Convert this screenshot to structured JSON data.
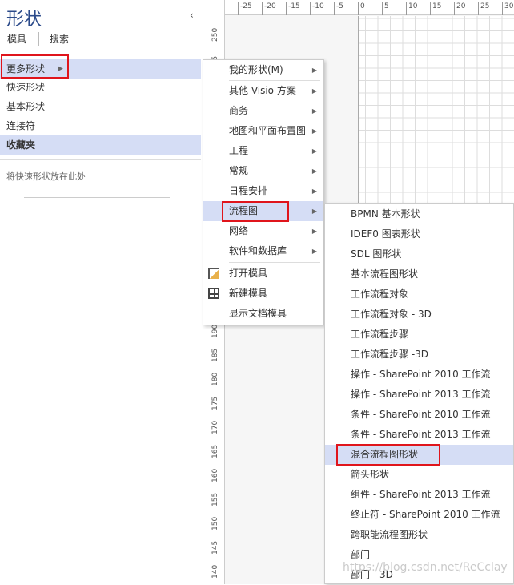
{
  "sidebar": {
    "title": "形状",
    "collapse_icon": "chevron-left-icon",
    "tabs": [
      "模具",
      "搜索"
    ],
    "items": [
      {
        "label": "更多形状",
        "selected": true
      },
      {
        "label": "快速形状"
      },
      {
        "label": "基本形状"
      },
      {
        "label": "连接符"
      },
      {
        "label": "收藏夹",
        "selected": true
      }
    ],
    "hint": "将快速形状放在此处"
  },
  "ruler": {
    "h": [
      "-25",
      "-20",
      "-15",
      "-10",
      "-5",
      "0",
      "5",
      "10",
      "15",
      "20",
      "25",
      "30"
    ],
    "v": [
      "250",
      "245",
      "190",
      "185",
      "180",
      "175",
      "170",
      "165",
      "160",
      "155",
      "150",
      "145",
      "140"
    ]
  },
  "menu": {
    "items": [
      "我的形状(M)",
      "其他 Visio 方案",
      "商务",
      "地图和平面布置图",
      "工程",
      "常规",
      "日程安排",
      "流程图",
      "网络",
      "软件和数据库"
    ],
    "actions": [
      "打开模具",
      "新建模具",
      "显示文档模具"
    ],
    "highlighted": "流程图"
  },
  "submenu": {
    "items": [
      "BPMN 基本形状",
      "IDEF0 图表形状",
      "SDL 图形状",
      "基本流程图形状",
      "工作流程对象",
      "工作流程对象 - 3D",
      "工作流程步骤",
      "工作流程步骤 -3D",
      "操作 - SharePoint 2010 工作流",
      "操作 - SharePoint 2013 工作流",
      "条件 - SharePoint 2010 工作流",
      "条件 - SharePoint 2013 工作流",
      "混合流程图形状",
      "箭头形状",
      "组件 - SharePoint 2013 工作流",
      "终止符 - SharePoint 2010 工作流",
      "跨职能流程图形状",
      "部门",
      "部门 - 3D"
    ],
    "highlighted": "混合流程图形状"
  },
  "watermark": "https://blog.csdn.net/ReCclay",
  "colors": {
    "highlight": "#d5ddf5",
    "annotation": "#e0151c",
    "title": "#2b4a8a"
  }
}
